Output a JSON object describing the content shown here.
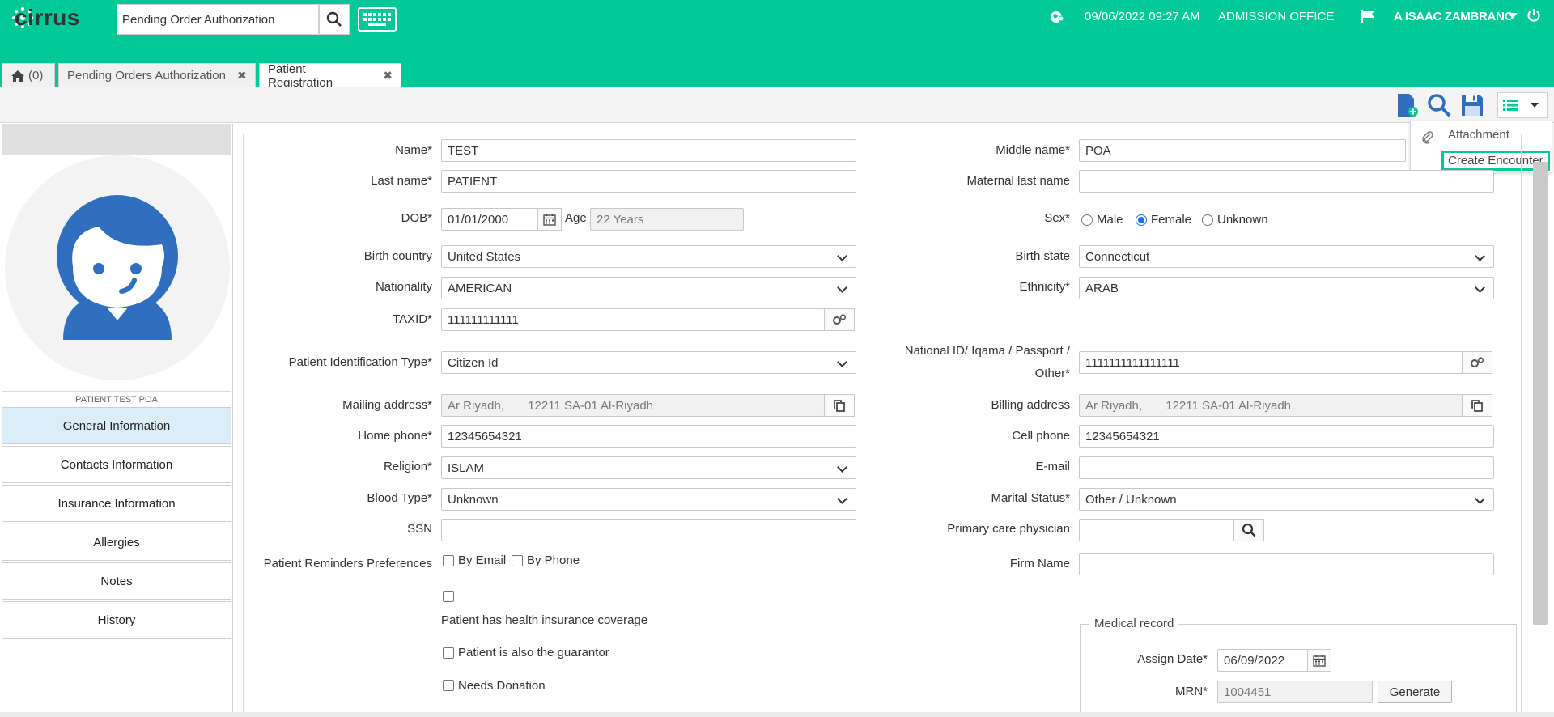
{
  "header": {
    "logo_text": "cirrus",
    "search_value": "Pending Order Authorization",
    "datetime": "09/06/2022 09:27 AM",
    "office": "ADMISSION OFFICE",
    "user": "A ISAAC ZAMBRANO",
    "colors": {
      "brand": "#00c896",
      "accent": "#1a73e8"
    }
  },
  "tabs": [
    {
      "label": "(0)",
      "icon": "home-icon"
    },
    {
      "label": "Pending Orders Authorization"
    },
    {
      "label": "Patient Registration"
    }
  ],
  "menu": {
    "items": [
      "Attachment",
      "Create Encounter"
    ]
  },
  "patient": {
    "display_name": "PATIENT TEST POA"
  },
  "nav": [
    "General Information",
    "Contacts Information",
    "Insurance Information",
    "Allergies",
    "Notes",
    "History"
  ],
  "form": {
    "name": {
      "label": "Name*",
      "value": "TEST"
    },
    "middle_name": {
      "label": "Middle name*",
      "value": "POA"
    },
    "last_name": {
      "label": "Last name*",
      "value": "PATIENT"
    },
    "maternal_last_name": {
      "label": "Maternal last name",
      "value": ""
    },
    "dob": {
      "label": "DOB*",
      "value": "01/01/2000"
    },
    "age": {
      "label": "Age",
      "value": "22 Years"
    },
    "sex": {
      "label": "Sex*",
      "options": [
        "Male",
        "Female",
        "Unknown"
      ],
      "selected": "Female"
    },
    "birth_country": {
      "label": "Birth country",
      "value": "United States"
    },
    "birth_state": {
      "label": "Birth state",
      "value": "Connecticut"
    },
    "nationality": {
      "label": "Nationality",
      "value": "AMERICAN"
    },
    "ethnicity": {
      "label": "Ethnicity*",
      "value": "ARAB"
    },
    "taxid": {
      "label": "TAXID*",
      "value": "111111111111"
    },
    "id_type": {
      "label": "Patient Identification Type*",
      "value": "Citizen Id"
    },
    "national_id": {
      "label_1": "National ID/ Iqama / Passport /",
      "label_2": "Other*",
      "value": "1111111111111111"
    },
    "mailing_address": {
      "label": "Mailing address*",
      "value": "Ar Riyadh,       12211 SA-01 Al-Riyadh"
    },
    "billing_address": {
      "label": "Billing address",
      "value": "Ar Riyadh,       12211 SA-01 Al-Riyadh"
    },
    "home_phone": {
      "label": "Home phone*",
      "value": "12345654321"
    },
    "cell_phone": {
      "label": "Cell phone",
      "value": "12345654321"
    },
    "religion": {
      "label": "Religion*",
      "value": "ISLAM"
    },
    "email": {
      "label": "E-mail",
      "value": ""
    },
    "blood_type": {
      "label": "Blood Type*",
      "value": "Unknown"
    },
    "marital_status": {
      "label": "Marital Status*",
      "value": "Other / Unknown"
    },
    "ssn": {
      "label": "SSN",
      "value": ""
    },
    "pcp": {
      "label": "Primary care physician",
      "value": ""
    },
    "reminders": {
      "label": "Patient Reminders Preferences",
      "by_email": "By Email",
      "by_phone": "By Phone"
    },
    "firm_name": {
      "label": "Firm Name",
      "value": ""
    },
    "insurance_coverage": "Patient has health insurance coverage",
    "guarantor": "Patient is also the guarantor",
    "donation": "Needs Donation",
    "medical_record": {
      "legend": "Medical record",
      "assign_date_label": "Assign Date*",
      "assign_date": "06/09/2022",
      "mrn_label": "MRN*",
      "mrn": "1004451",
      "generate": "Generate"
    }
  }
}
